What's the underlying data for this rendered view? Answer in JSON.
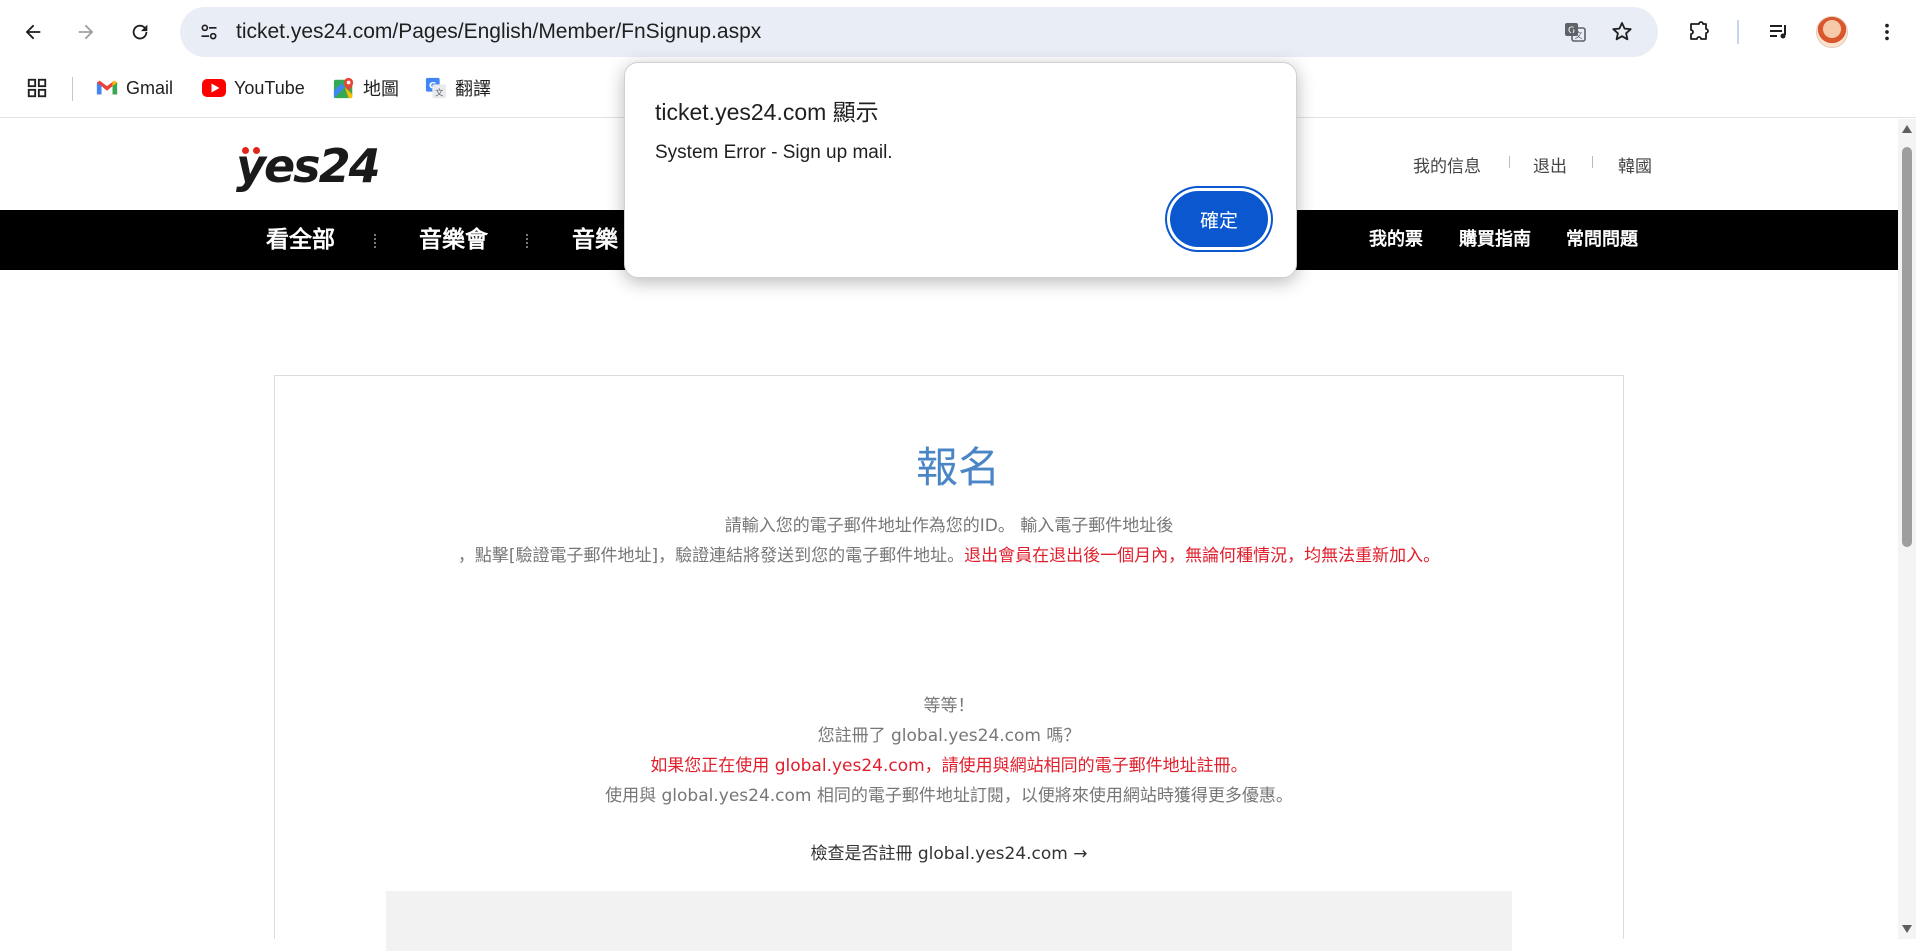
{
  "browser": {
    "url": "ticket.yes24.com/Pages/English/Member/FnSignup.aspx",
    "bookmarks": [
      {
        "label": "Gmail",
        "icon": "gmail-icon"
      },
      {
        "label": "YouTube",
        "icon": "youtube-icon"
      },
      {
        "label": "地圖",
        "icon": "maps-icon"
      },
      {
        "label": "翻譯",
        "icon": "translate-icon"
      }
    ]
  },
  "site": {
    "logo_text": "yes24",
    "util_links": [
      "我的信息",
      "退出",
      "韓國"
    ],
    "gnb": [
      "看全部",
      "音樂會",
      "音樂"
    ],
    "gnb_right": [
      "我的票",
      "購買指南",
      "常問問題"
    ]
  },
  "signup": {
    "title": "報名",
    "desc_line1": "請輸入您的電子郵件地址作為您的ID。 輸入電子郵件地址後",
    "desc_line2": "，點擊[驗證電子郵件地址]，驗證連結將發送到您的電子郵件地址。",
    "desc_line2_red": "退出會員在退出後一個月內，無論何種情況，均無法重新加入。",
    "wait": "等等！",
    "registered_q": "您註冊了 global.yes24.com 嗎？",
    "red_note": "如果您正在使用 global.yes24.com，請使用與網站相同的電子郵件地址註冊。",
    "benefit": "使用與 global.yes24.com 相同的電子郵件地址訂閱，以便將來使用網站時獲得更多優惠。",
    "check_link": "檢查是否註冊 global.yes24.com →"
  },
  "dialog": {
    "title": "ticket.yes24.com 顯示",
    "message": "System Error - Sign up mail.",
    "ok_label": "確定"
  },
  "colors": {
    "accent_blue": "#0b57d0",
    "title_blue": "#4a86c5",
    "warning_red": "#e01e2c",
    "logo_red": "#e1251b"
  }
}
